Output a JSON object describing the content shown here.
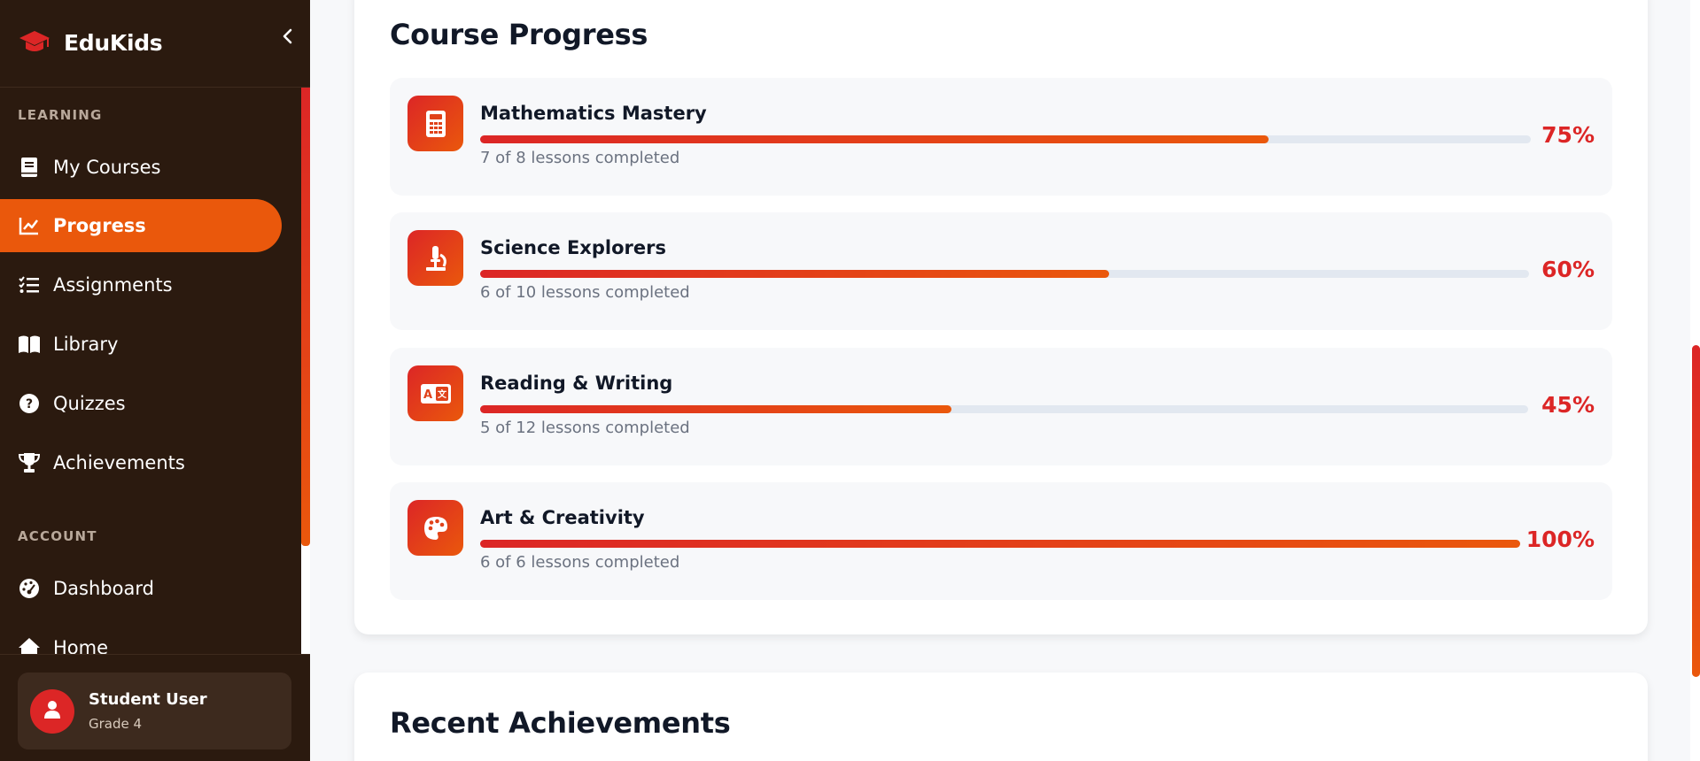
{
  "app": {
    "brand": "EduKids",
    "accent_color": "#EA580C",
    "accent_red": "#DC2626",
    "sidebar_bg": "#2B1A0F"
  },
  "sidebar": {
    "collapse_icon": "chevron-left-icon",
    "sections": [
      {
        "title": "LEARNING",
        "items": [
          {
            "label": "My Courses",
            "icon": "book-icon",
            "active": false
          },
          {
            "label": "Progress",
            "icon": "chart-line-icon",
            "active": true
          },
          {
            "label": "Assignments",
            "icon": "tasks-icon",
            "active": false
          },
          {
            "label": "Library",
            "icon": "open-book-icon",
            "active": false
          },
          {
            "label": "Quizzes",
            "icon": "question-circle-icon",
            "active": false
          },
          {
            "label": "Achievements",
            "icon": "trophy-icon",
            "active": false
          }
        ]
      },
      {
        "title": "ACCOUNT",
        "items": [
          {
            "label": "Dashboard",
            "icon": "gauge-icon",
            "active": false
          },
          {
            "label": "Home",
            "icon": "home-icon",
            "active": false
          }
        ]
      }
    ],
    "user": {
      "name": "Student User",
      "grade": "Grade 4",
      "avatar_icon": "user-icon"
    }
  },
  "main": {
    "course_progress": {
      "title": "Course Progress",
      "courses": [
        {
          "name": "Mathematics Mastery",
          "lessons": "7 of 8 lessons completed",
          "percent_label": "75%",
          "progress": 0.75,
          "icon": "calculator-icon"
        },
        {
          "name": "Science Explorers",
          "lessons": "6 of 10 lessons completed",
          "percent_label": "60%",
          "progress": 0.6,
          "icon": "microscope-icon"
        },
        {
          "name": "Reading & Writing",
          "lessons": "5 of 12 lessons completed",
          "percent_label": "45%",
          "progress": 0.45,
          "icon": "language-icon"
        },
        {
          "name": "Art & Creativity",
          "lessons": "6 of 6 lessons completed",
          "percent_label": "100%",
          "progress": 1.0,
          "icon": "palette-icon"
        }
      ]
    },
    "recent_achievements": {
      "title": "Recent Achievements"
    }
  }
}
